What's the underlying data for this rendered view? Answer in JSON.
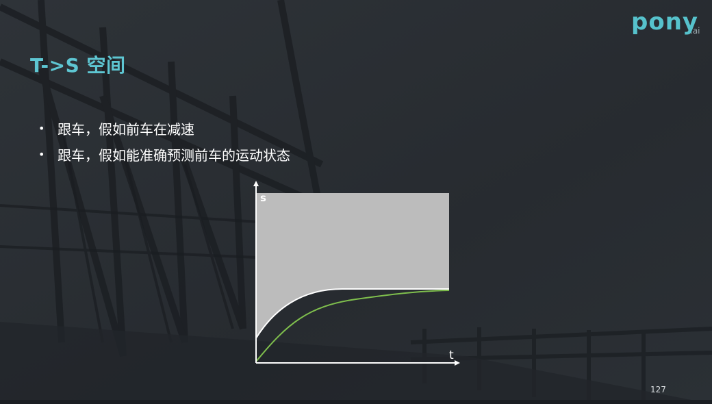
{
  "logo": {
    "word": "pony",
    "suffix": ".ai",
    "color": "#56c2cc"
  },
  "slide": {
    "title": "T->S 空间",
    "bullets": [
      "跟车，假如前车在减速",
      "跟车，假如能准确预测前车的运动状态"
    ],
    "page_number": "127"
  },
  "diagram": {
    "y_axis_label": "s",
    "x_axis_label": "t",
    "colors": {
      "region_fill": "#bcbcbc",
      "axis": "#ffffff",
      "boundary": "#ffffff",
      "trajectory": "#7fbf4d"
    }
  }
}
